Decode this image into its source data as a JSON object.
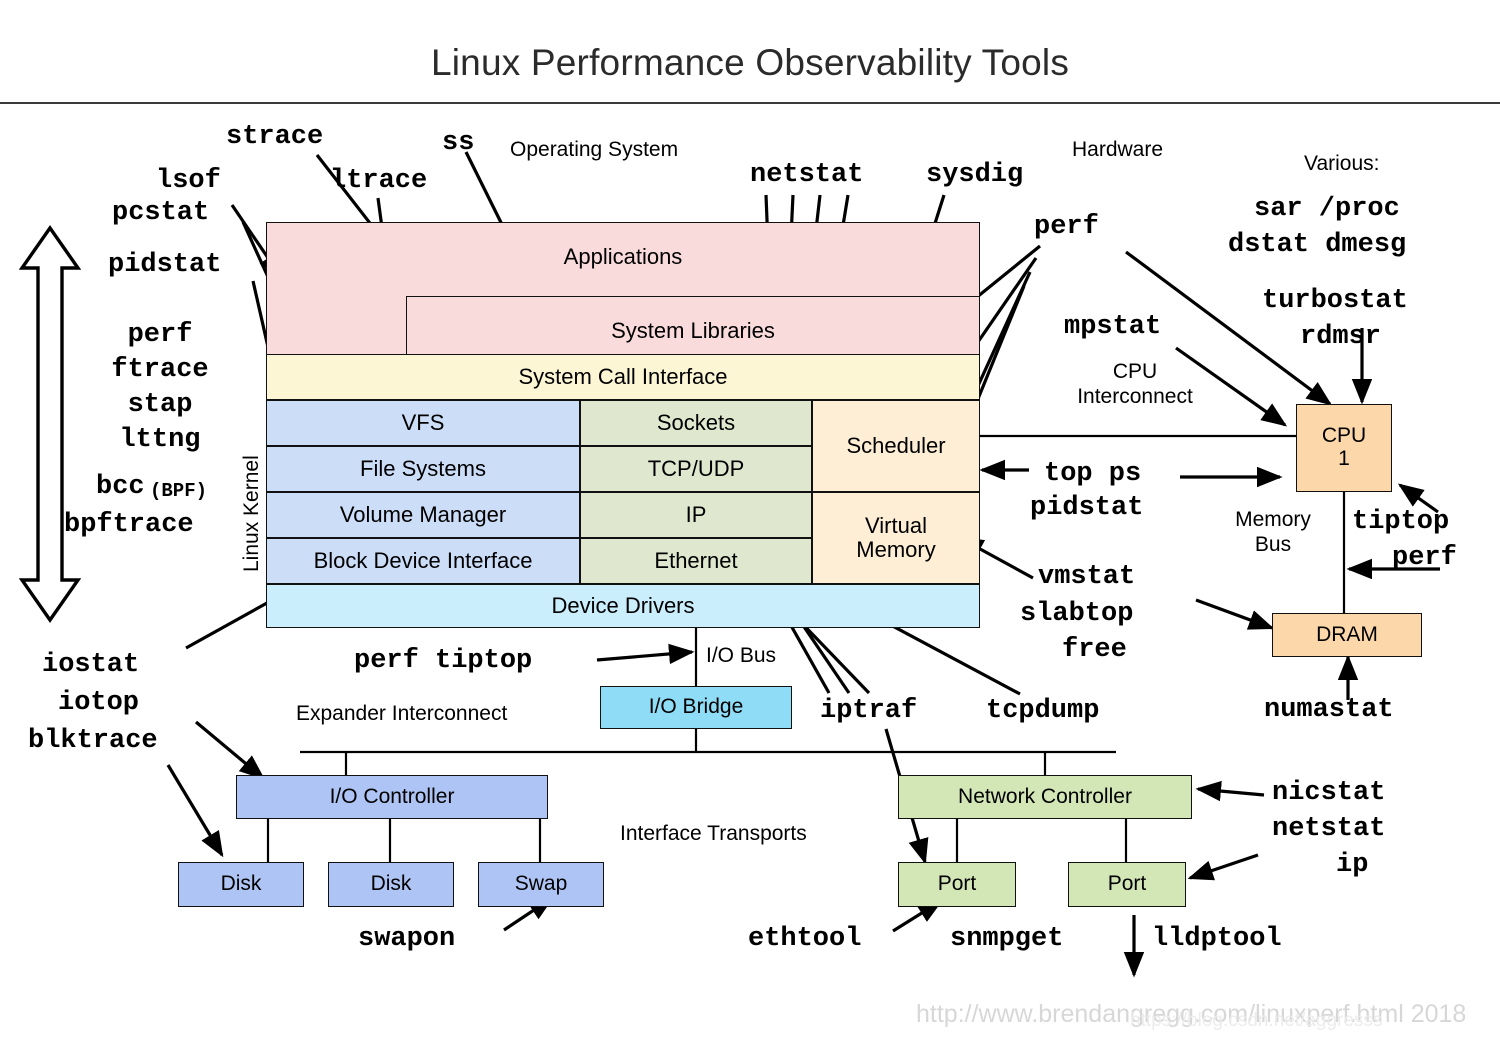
{
  "title": "Linux Performance Observability Tools",
  "footer": {
    "url": "http://www.brendangregg.com/linuxperf.html 2018",
    "watermark": "https://blog.csdn.net/aggresss"
  },
  "section_labels": {
    "operating_system": "Operating System",
    "hardware": "Hardware",
    "various": "Various:",
    "linux_kernel": "Linux Kernel",
    "cpu_interconnect": "CPU\nInterconnect",
    "memory_bus": "Memory\nBus",
    "io_bus": "I/O Bus",
    "expander_interconnect": "Expander Interconnect",
    "interface_transports": "Interface Transports"
  },
  "os_stack": {
    "applications": "Applications",
    "system_libraries": "System Libraries",
    "system_call_interface": "System Call Interface",
    "vfs": "VFS",
    "file_systems": "File Systems",
    "volume_manager": "Volume Manager",
    "block_device_interface": "Block Device Interface",
    "sockets": "Sockets",
    "tcp_udp": "TCP/UDP",
    "ip": "IP",
    "ethernet": "Ethernet",
    "scheduler": "Scheduler",
    "virtual_memory": "Virtual\nMemory",
    "device_drivers": "Device Drivers"
  },
  "hardware": {
    "cpu": "CPU\n1",
    "dram": "DRAM",
    "io_bridge": "I/O Bridge",
    "io_controller": "I/O Controller",
    "disk1": "Disk",
    "disk2": "Disk",
    "swap": "Swap",
    "network_controller": "Network Controller",
    "port1": "Port",
    "port2": "Port"
  },
  "tools": {
    "strace": "strace",
    "ss": "ss",
    "lsof": "lsof",
    "pcstat": "pcstat",
    "ltrace": "ltrace",
    "pidstat": "pidstat",
    "netstat": "netstat",
    "sysdig": "sysdig",
    "perf_top": "perf",
    "mpstat": "mpstat",
    "sar_proc": "sar /proc",
    "dstat_dmesg": "dstat dmesg",
    "turbostat": "turbostat",
    "rdmsr": "rdmsr",
    "left_block": "perf\nftrace\nstap\nlttng",
    "bcc": "bcc",
    "bcc_bpf": "(BPF)",
    "bpftrace": "bpftrace",
    "top_ps": "top ps",
    "pidstat_cpu": "pidstat",
    "tiptop": "tiptop",
    "perf_mem": "perf",
    "vmstat": "vmstat",
    "slabtop": "slabtop",
    "free": "free",
    "numastat": "numastat",
    "iostat": "iostat",
    "iotop": "iotop",
    "blktrace": "blktrace",
    "perf_tiptop": "perf tiptop",
    "iptraf": "iptraf",
    "tcpdump": "tcpdump",
    "swapon": "swapon",
    "ethtool": "ethtool",
    "snmpget": "snmpget",
    "lldptool": "lldptool",
    "nicstat": "nicstat",
    "netstat_nic": "netstat",
    "ip": "ip"
  },
  "colors": {
    "pink": "#fadbdb",
    "cream": "#fcf6d5",
    "blue": "#ccddf8",
    "green": "#dfe8cf",
    "orange": "#fdeed5",
    "cyan": "#cbeefc",
    "mid_blue": "#aec4f5",
    "mid_cyan": "#8fdcf7",
    "mid_green": "#d3e7b6",
    "mid_orange": "#fbd7aa",
    "stroke": "#111111"
  }
}
